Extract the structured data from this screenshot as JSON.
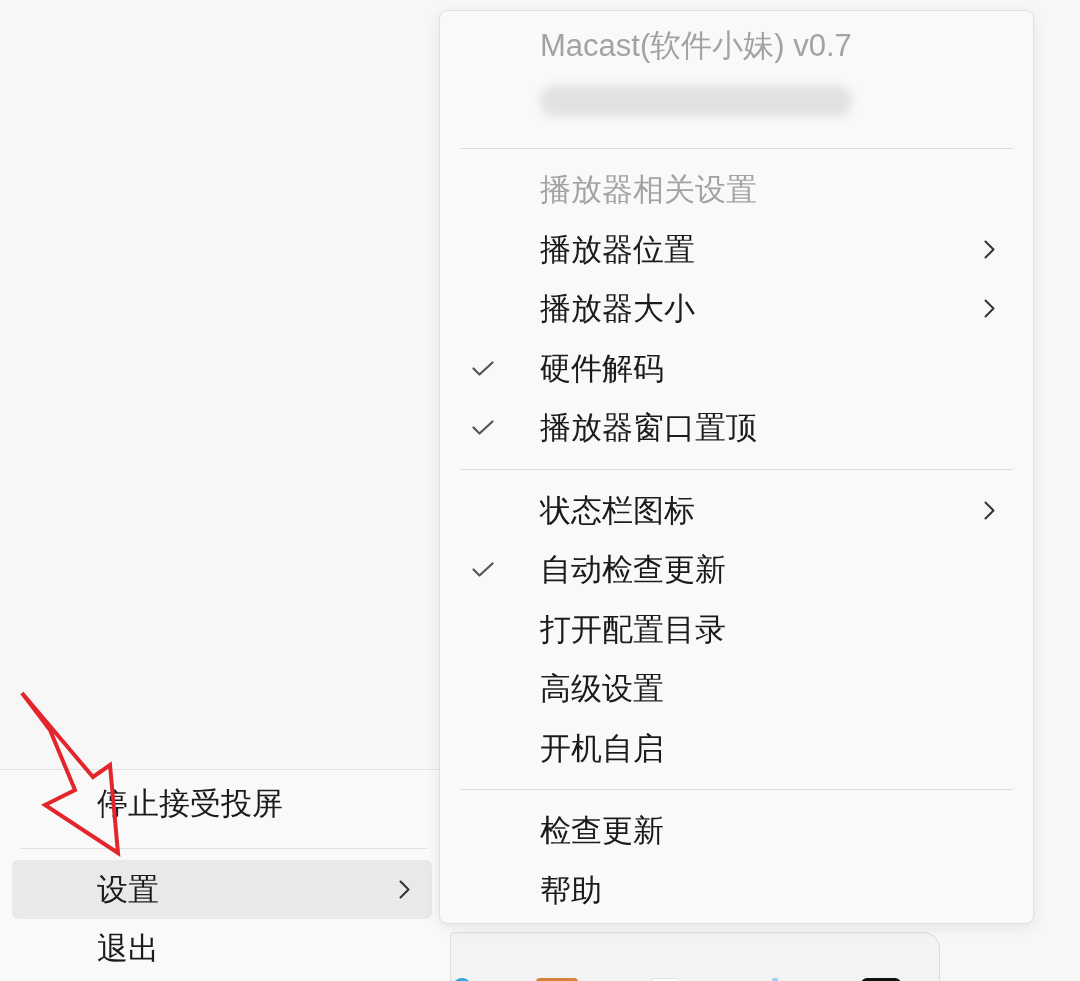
{
  "tray_menu": {
    "items": [
      {
        "kind": "item",
        "label": "停止接受投屏",
        "selected": false,
        "submenu": false
      },
      {
        "kind": "separator"
      },
      {
        "kind": "item",
        "label": "设置",
        "selected": true,
        "submenu": true
      },
      {
        "kind": "item",
        "label": "退出",
        "selected": false,
        "submenu": false
      }
    ]
  },
  "settings_submenu": {
    "items": [
      {
        "kind": "title",
        "label": "Macast(软件小妹) v0.7"
      },
      {
        "kind": "redacted"
      },
      {
        "kind": "separator"
      },
      {
        "kind": "header",
        "label": "播放器相关设置"
      },
      {
        "kind": "item",
        "label": "播放器位置",
        "checked": false,
        "submenu": true
      },
      {
        "kind": "item",
        "label": "播放器大小",
        "checked": false,
        "submenu": true
      },
      {
        "kind": "item",
        "label": "硬件解码",
        "checked": true,
        "submenu": false
      },
      {
        "kind": "item",
        "label": "播放器窗口置顶",
        "checked": true,
        "submenu": false
      },
      {
        "kind": "separator"
      },
      {
        "kind": "item",
        "label": "状态栏图标",
        "checked": false,
        "submenu": true
      },
      {
        "kind": "item",
        "label": "自动检查更新",
        "checked": true,
        "submenu": false
      },
      {
        "kind": "item",
        "label": "打开配置目录",
        "checked": false,
        "submenu": false
      },
      {
        "kind": "item",
        "label": "高级设置",
        "checked": false,
        "submenu": false
      },
      {
        "kind": "item",
        "label": "开机自启",
        "checked": false,
        "submenu": false
      },
      {
        "kind": "separator"
      },
      {
        "kind": "item",
        "label": "检查更新",
        "checked": false,
        "submenu": false
      },
      {
        "kind": "item",
        "label": "帮助",
        "checked": false,
        "submenu": false
      }
    ]
  }
}
